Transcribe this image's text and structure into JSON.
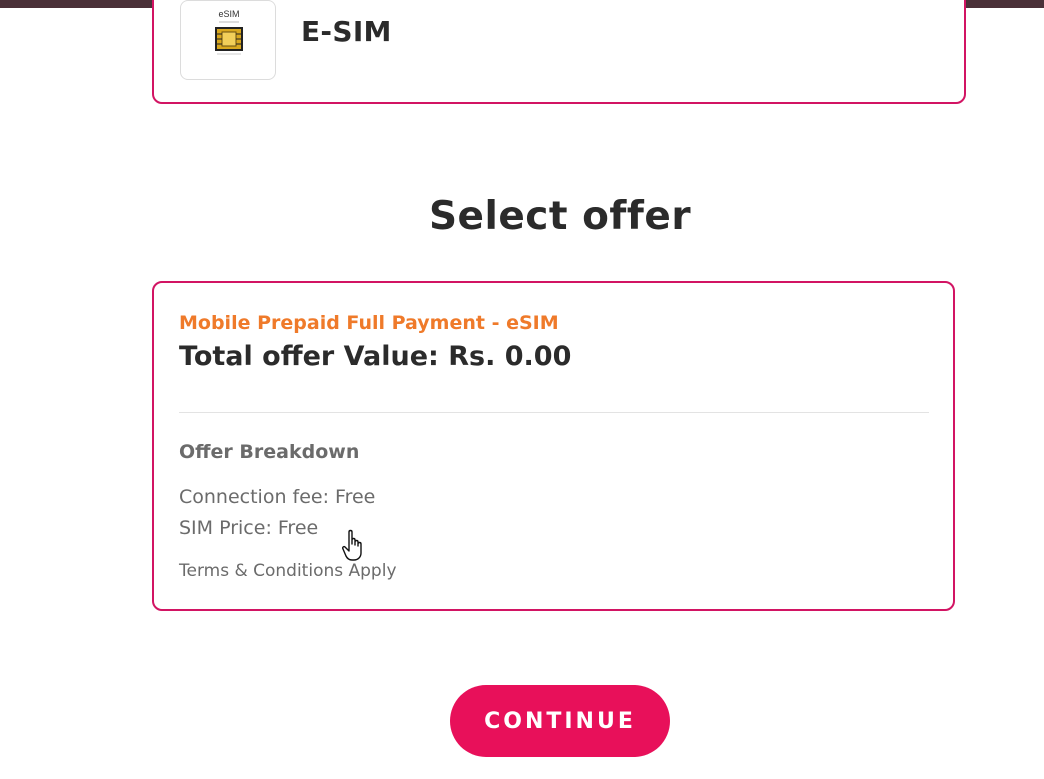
{
  "sim_option": {
    "icon_label": "eSIM",
    "title": "E-SIM"
  },
  "offer_section": {
    "heading": "Select offer"
  },
  "offer": {
    "name": "Mobile Prepaid Full Payment - eSIM",
    "total_value": "Total offer Value: Rs. 0.00",
    "breakdown_heading": "Offer Breakdown",
    "connection_fee": "Connection fee: Free",
    "sim_price": "SIM Price: Free",
    "terms": "Terms & Conditions Apply"
  },
  "actions": {
    "continue_label": "CONTINUE"
  },
  "colors": {
    "accent_border": "#d21463",
    "offer_name": "#ef7a2a",
    "button": "#e8105a",
    "top_strip": "#4a3038"
  },
  "icons": [
    "esim-chip-icon",
    "hand-pointer-icon"
  ]
}
